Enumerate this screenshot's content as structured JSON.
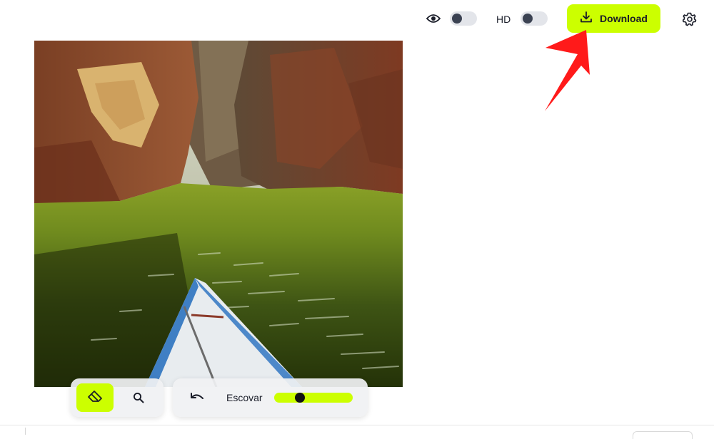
{
  "toolbar": {
    "preview_icon": "eye-icon",
    "preview_toggle_on": false,
    "hd_label": "HD",
    "hd_toggle_on": false,
    "download_label": "Download",
    "download_icon": "download-icon",
    "settings_icon": "gear-icon",
    "accent_color": "#ccff00"
  },
  "annotation": {
    "arrow_icon": "red-pointer-arrow-icon",
    "arrow_color": "#ff1a1a"
  },
  "canvas": {
    "image_icon": "canyon-boat-photo"
  },
  "tools": {
    "eraser_icon": "eraser-icon",
    "zoom_icon": "magnifier-icon",
    "undo_icon": "undo-icon",
    "brush_label": "Escovar",
    "brush_size_fraction": 0.3
  }
}
